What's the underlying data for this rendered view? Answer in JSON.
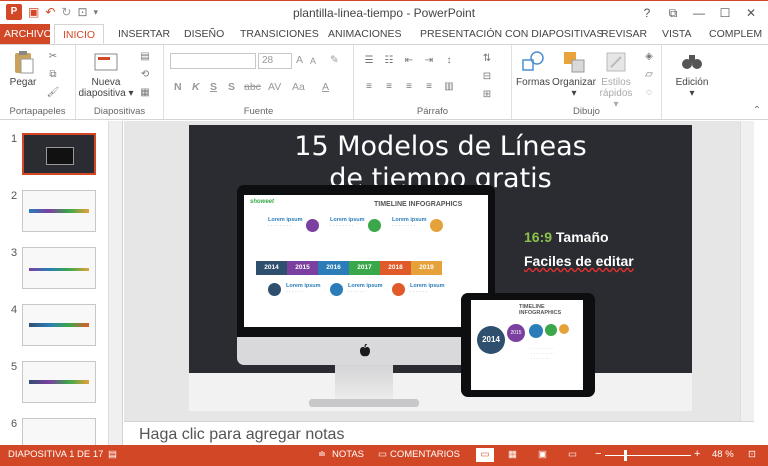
{
  "window": {
    "title": "plantilla-linea-tiempo - PowerPoint",
    "help": "?",
    "controls": [
      "⧉",
      "—",
      "☐",
      "✕"
    ]
  },
  "quick_access": {
    "logo": "P",
    "save": "💾",
    "undo": "↶",
    "redo": "↻",
    "start": "⏵"
  },
  "tabs": [
    {
      "label": "ARCHIVO"
    },
    {
      "label": "INICIO"
    },
    {
      "label": "INSERTAR"
    },
    {
      "label": "DISEÑO"
    },
    {
      "label": "TRANSICIONES"
    },
    {
      "label": "ANIMACIONES"
    },
    {
      "label": "PRESENTACIÓN CON DIAPOSITIVAS"
    },
    {
      "label": "REVISAR"
    },
    {
      "label": "VISTA"
    },
    {
      "label": "COMPLEM"
    }
  ],
  "ribbon": {
    "groups": {
      "portapapeles": "Portapapeles",
      "diapositivas": "Diapositivas",
      "fuente": "Fuente",
      "parrafo": "Párrafo",
      "dibujo": "Dibujo"
    },
    "buttons": {
      "pegar": "Pegar",
      "nueva_1": "Nueva",
      "nueva_2": "diapositiva ▾",
      "formas": "Formas",
      "organizar_1": "Organizar",
      "organizar_2": "▾",
      "estilos_1": "Estilos",
      "estilos_2": "rápidos ▾",
      "edicion_1": "Edición",
      "edicion_2": "▾"
    },
    "font_size": "28",
    "format_buttons": [
      "N",
      "K",
      "S",
      "S",
      "abc",
      "AV",
      "Aa",
      "A"
    ]
  },
  "thumbnails": [
    {
      "num": "1"
    },
    {
      "num": "2"
    },
    {
      "num": "3"
    },
    {
      "num": "4"
    },
    {
      "num": "5"
    },
    {
      "num": "6"
    }
  ],
  "slide": {
    "title_line1": "15 Modelos de Líneas",
    "title_line2": "de tiempo gratis",
    "ratio_num": "16:9",
    "ratio_text": " Tamaño",
    "edit_text": "Faciles de editar",
    "brand": "showeet",
    "infographic_title": "TIMELINE INFOGRAPHICS",
    "tablet_year": "2014",
    "tablet_year2": "2015",
    "lorem": "Lorem ipsum",
    "apple": "",
    "years": [
      {
        "label": "2014",
        "color": "#2f4f6f"
      },
      {
        "label": "2015",
        "color": "#7b3fa0"
      },
      {
        "label": "2016",
        "color": "#2a7db8"
      },
      {
        "label": "2017",
        "color": "#3aa84a"
      },
      {
        "label": "2018",
        "color": "#e05a2a"
      },
      {
        "label": "2019",
        "color": "#e6a23a"
      }
    ]
  },
  "notes": {
    "placeholder": "Haga clic para agregar notas"
  },
  "statusbar": {
    "slide_info": "DIAPOSITIVA 1 DE 17",
    "notas": "NOTAS",
    "comentarios": "COMENTARIOS",
    "zoom_minus": "−",
    "zoom_plus": "+",
    "zoom": "48 %"
  },
  "colors": {
    "accent": "#d24726",
    "slide_bg": "#2a2c31"
  }
}
